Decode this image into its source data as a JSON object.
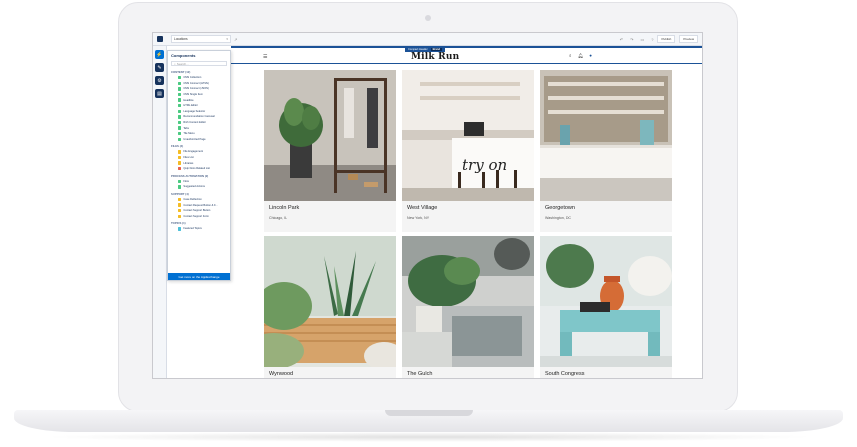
{
  "builder": {
    "location": "Locations",
    "publish_label": "Publish",
    "preview_label": "Preview"
  },
  "components_panel": {
    "title": "Components",
    "search_placeholder": "Search...",
    "sections": [
      {
        "name": "CONTENT (12)",
        "items": [
          {
            "label": "CMS Collection",
            "color": "#4bca81"
          },
          {
            "label": "CMS Connect (HTML)",
            "color": "#4bca81"
          },
          {
            "label": "CMS Connect (JSON)",
            "color": "#4bca81"
          },
          {
            "label": "CMS Single Item",
            "color": "#4bca81"
          },
          {
            "label": "Headline",
            "color": "#4bca81"
          },
          {
            "label": "HTML Editor",
            "color": "#4bca81"
          },
          {
            "label": "Language Selector",
            "color": "#4bca81"
          },
          {
            "label": "Recommendation Carousel",
            "color": "#4bca81"
          },
          {
            "label": "Rich Content Editor",
            "color": "#4bca81"
          },
          {
            "label": "Tabs",
            "color": "#4bca81"
          },
          {
            "label": "Tile Menu",
            "color": "#4bca81"
          },
          {
            "label": "Unauthorized Page",
            "color": "#4bca81"
          }
        ]
      },
      {
        "name": "FILES (4)",
        "items": [
          {
            "label": "File Engagement",
            "color": "#f4bc25"
          },
          {
            "label": "Files List",
            "color": "#f4bc25"
          },
          {
            "label": "Libraries",
            "color": "#f4bc25"
          },
          {
            "label": "Quip Docs Related List",
            "color": "#e8604c"
          }
        ]
      },
      {
        "name": "PROCESS AUTOMATION (2)",
        "items": [
          {
            "label": "Flow",
            "color": "#4bca81"
          },
          {
            "label": "Suggested Actions",
            "color": "#4bca81"
          }
        ]
      },
      {
        "name": "SUPPORT (4)",
        "items": [
          {
            "label": "Case Deflection",
            "color": "#f4bc25"
          },
          {
            "label": "Contact Request Button & F...",
            "color": "#f4bc25"
          },
          {
            "label": "Contact Support Button",
            "color": "#f4bc25"
          },
          {
            "label": "Contact Support Form",
            "color": "#f4bc25"
          }
        ]
      },
      {
        "name": "TOPICS (1)",
        "items": [
          {
            "label": "Featured Topics",
            "color": "#4bc0d9"
          }
        ]
      }
    ],
    "footer_label": "Get more on the AppExchange"
  },
  "site": {
    "brand": "Milk Run",
    "compact_header_label": "Compact Header",
    "compact_header_badge": "Brand"
  },
  "locations": [
    {
      "name": "Lincoln Park",
      "city": "Chicago, IL"
    },
    {
      "name": "West Village",
      "city": "New York, NY"
    },
    {
      "name": "Georgetown",
      "city": "Washington, DC"
    },
    {
      "name": "Wynwood",
      "city": ""
    },
    {
      "name": "The Gulch",
      "city": ""
    },
    {
      "name": "South Congress",
      "city": ""
    }
  ]
}
